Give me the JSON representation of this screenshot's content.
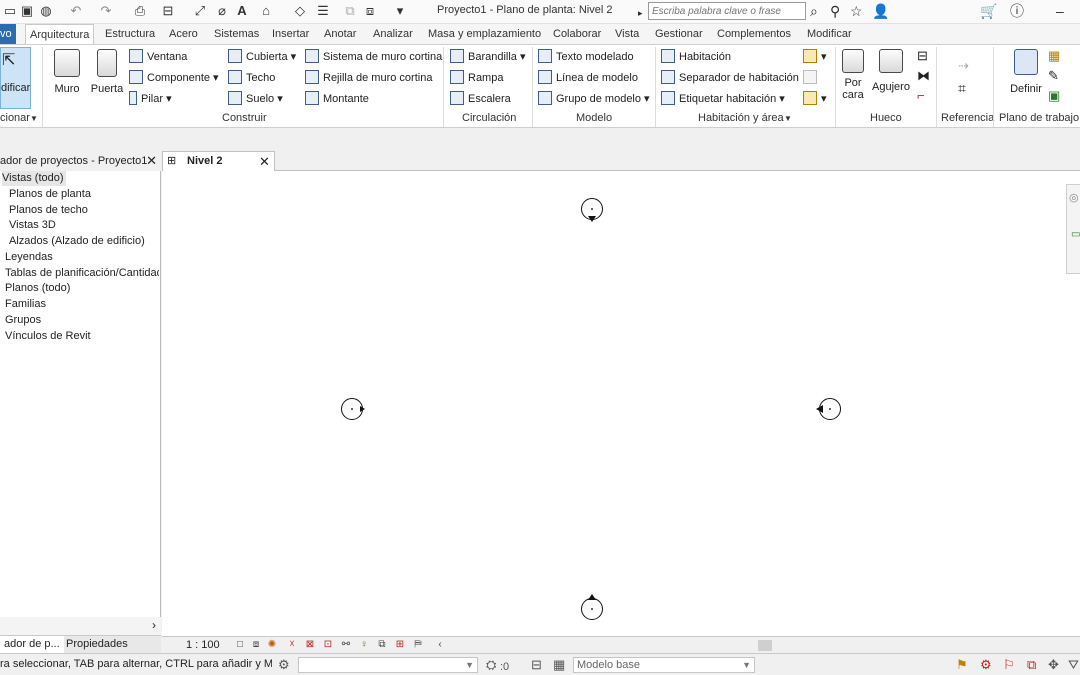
{
  "titlebar": {
    "title": "Proyecto1 - Plano de planta: Nivel 2",
    "search_placeholder": "Escriba palabra clave o frase",
    "help_label": "?"
  },
  "tabs": {
    "file": "vo",
    "items": [
      "Arquitectura",
      "Estructura",
      "Acero",
      "Sistemas",
      "Insertar",
      "Anotar",
      "Analizar",
      "Masa y emplazamiento",
      "Colaborar",
      "Vista",
      "Gestionar",
      "Complementos",
      "Modificar"
    ]
  },
  "ribbon": {
    "select": {
      "modify_label": "dificar",
      "panel_label": "cionar"
    },
    "build": {
      "muro": "Muro",
      "puerta": "Puerta",
      "ventana": "Ventana",
      "componente": "Componente",
      "pilar": "Pilar",
      "cubierta": "Cubierta",
      "techo": "Techo",
      "suelo": "Suelo",
      "sistema_muro": "Sistema de muro cortina",
      "rejilla": "Rejilla de muro cortina",
      "montante": "Montante",
      "panel_label": "Construir"
    },
    "circulation": {
      "barandilla": "Barandilla",
      "rampa": "Rampa",
      "escalera": "Escalera",
      "panel_label": "Circulación"
    },
    "model": {
      "texto": "Texto modelado",
      "linea": "Línea de modelo",
      "grupo": "Grupo de modelo",
      "panel_label": "Modelo"
    },
    "room": {
      "habitacion": "Habitación",
      "separador": "Separador  de habitación",
      "etiquetar": "Etiquetar  habitación",
      "panel_label": "Habitación y área"
    },
    "opening": {
      "por_cara_1": "Por",
      "por_cara_2": "cara",
      "agujero": "Agujero",
      "panel_label": "Hueco"
    },
    "datum": {
      "panel_label": "Referencia"
    },
    "workplane": {
      "definir": "Definir",
      "panel_label": "Plano de trabajo"
    }
  },
  "browser": {
    "title": "ador de proyectos - Proyecto1",
    "items": [
      "Vistas (todo)",
      "Planos de planta",
      "Planos de techo",
      "Vistas 3D",
      "Alzados (Alzado de edificio)",
      "Leyendas",
      "Tablas de planificación/Cantidades",
      "Planos (todo)",
      "Familias",
      "Grupos",
      "Vínculos de Revit"
    ],
    "bottom_tabs": [
      "ador de p...",
      "Propiedades"
    ]
  },
  "view": {
    "tab_label": "Nivel 2",
    "scale": "1 : 100"
  },
  "statusbar": {
    "text": "ra seleccionar, TAB para alternar, CTRL para añadir y MAYÚS para anular selección.",
    "counter": ":0",
    "model": "Modelo base"
  }
}
